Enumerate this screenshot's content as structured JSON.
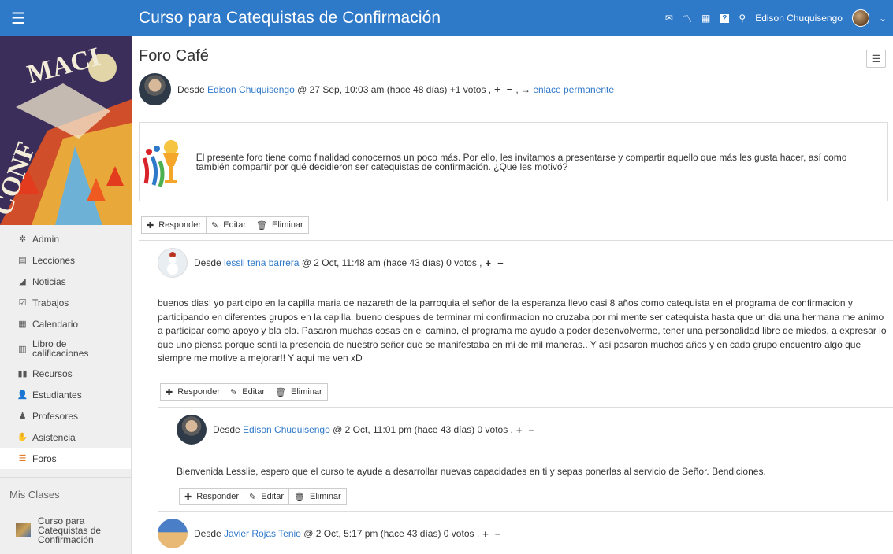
{
  "topbar": {
    "course_title": "Curso para Catequistas de Confirmación",
    "user_name": "Edison Chuquisengo"
  },
  "sidebar": {
    "banner_text": "CONFIRMACION",
    "items": [
      {
        "label": "Admin",
        "icon": "gear-icon"
      },
      {
        "label": "Lecciones",
        "icon": "book-icon"
      },
      {
        "label": "Noticias",
        "icon": "megaphone-icon"
      },
      {
        "label": "Trabajos",
        "icon": "checklist-icon"
      },
      {
        "label": "Calendario",
        "icon": "calendar-icon"
      },
      {
        "label": "Libro de calificaciones",
        "icon": "gradebook-icon"
      },
      {
        "label": "Recursos",
        "icon": "library-icon"
      },
      {
        "label": "Estudiantes",
        "icon": "student-icon"
      },
      {
        "label": "Profesores",
        "icon": "teacher-icon"
      },
      {
        "label": "Asistencia",
        "icon": "handshake-icon"
      },
      {
        "label": "Foros",
        "icon": "forum-icon"
      }
    ],
    "mis_clases_label": "Mis Clases",
    "class_name": "Curso para Catequistas de Confirmación"
  },
  "forum": {
    "title": "Foro Café",
    "main_post": {
      "prefix": "Desde",
      "author": "Edison Chuquisengo",
      "date": "@ 27 Sep, 10:03 am (hace 48 días) +1 votos ,",
      "permalink_arrow": ", →",
      "permalink": "enlace permanente",
      "body": "El presente foro tiene como finalidad conocernos un poco más. Por ello, les invitamos a presentarse y compartir aquello que más les gusta hacer, así como también compartir por qué decidieron ser catequistas de confirmación. ¿Qué les motivó?"
    },
    "actions": {
      "reply": "Responder",
      "edit": "Editar",
      "delete": "Eliminar"
    },
    "reply1": {
      "prefix": "Desde",
      "author": "lessli tena barrera",
      "date": "@ 2 Oct, 11:48 am (hace 43 días) 0 votos ,",
      "body": "buenos dias! yo participo en la capilla maria de nazareth de la parroquia el señor de la esperanza llevo casi 8 años como catequista en el programa de confirmacion y participando en diferentes grupos en la capilla. bueno despues de terminar mi confirmacion no cruzaba por mi mente ser catequista hasta que un dia una hermana me animo a participar como apoyo y bla bla. Pasaron muchas cosas en el camino, el programa me ayudo a poder desenvolverme, tener una personalidad libre de miedos, a expresar lo que uno piensa porque  senti la presencia de nuestro señor que se manifestaba en mi de mil maneras.. Y asi pasaron muchos años y en cada grupo encuentro algo que siempre me motive a mejorar!! Y aqui me ven xD"
    },
    "reply2": {
      "prefix": "Desde",
      "author": "Edison Chuquisengo",
      "date": "@ 2 Oct, 11:01 pm (hace 43 días) 0 votos ,",
      "body": "Bienvenida Lesslie, espero que el curso te ayude a desarrollar nuevas capacidades en ti y sepas ponerlas al servicio de Señor. Bendiciones."
    },
    "reply3": {
      "prefix": "Desde",
      "author": "Javier Rojas Tenio",
      "date": "@ 2 Oct, 5:17 pm (hace 43 días) 0 votos ,"
    },
    "vote_up": "+",
    "vote_down": "−"
  }
}
